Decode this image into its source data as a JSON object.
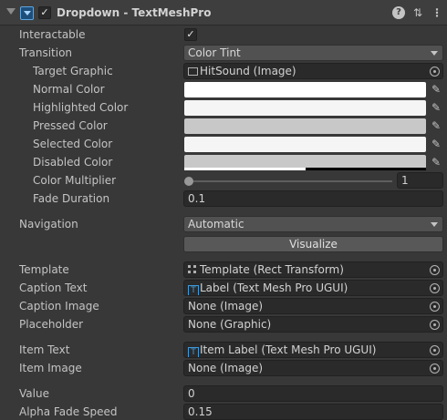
{
  "header": {
    "title": "Dropdown - TextMeshPro",
    "enabled": "✓",
    "icons": [
      "foldout-arrow-icon",
      "component-icon",
      "help-icon",
      "preset-sliders-icon",
      "kebab-menu-icon"
    ]
  },
  "interactable": {
    "label": "Interactable",
    "checked": "✓"
  },
  "transition": {
    "label": "Transition",
    "value": "Color Tint"
  },
  "target_graphic": {
    "label": "Target Graphic",
    "value": "HitSound (Image)"
  },
  "colors": {
    "normal": {
      "label": "Normal Color",
      "hex": "#ffffff",
      "alpha": 1.0
    },
    "highlighted": {
      "label": "Highlighted Color",
      "hex": "#f5f5f5",
      "alpha": 1.0
    },
    "pressed": {
      "label": "Pressed Color",
      "hex": "#c8c8c8",
      "alpha": 1.0
    },
    "selected": {
      "label": "Selected Color",
      "hex": "#f5f5f5",
      "alpha": 1.0
    },
    "disabled": {
      "label": "Disabled Color",
      "hex": "#c8c8c8",
      "alpha": 0.5
    }
  },
  "color_multiplier": {
    "label": "Color Multiplier",
    "value": "1",
    "slider_fraction": 0.0
  },
  "fade_duration": {
    "label": "Fade Duration",
    "value": "0.1"
  },
  "navigation": {
    "label": "Navigation",
    "value": "Automatic",
    "visualize_label": "Visualize"
  },
  "template": {
    "label": "Template",
    "value": "Template (Rect Transform)"
  },
  "caption_text": {
    "label": "Caption Text",
    "value": "Label (Text Mesh Pro UGUI)"
  },
  "caption_image": {
    "label": "Caption Image",
    "value": "None (Image)"
  },
  "placeholder": {
    "label": "Placeholder",
    "value": "None (Graphic)"
  },
  "item_text": {
    "label": "Item Text",
    "value": "Item Label (Text Mesh Pro UGUI)"
  },
  "item_image": {
    "label": "Item Image",
    "value": "None (Image)"
  },
  "value": {
    "label": "Value",
    "value": "0"
  },
  "alpha_fade_speed": {
    "label": "Alpha Fade Speed",
    "value": "0.15"
  }
}
